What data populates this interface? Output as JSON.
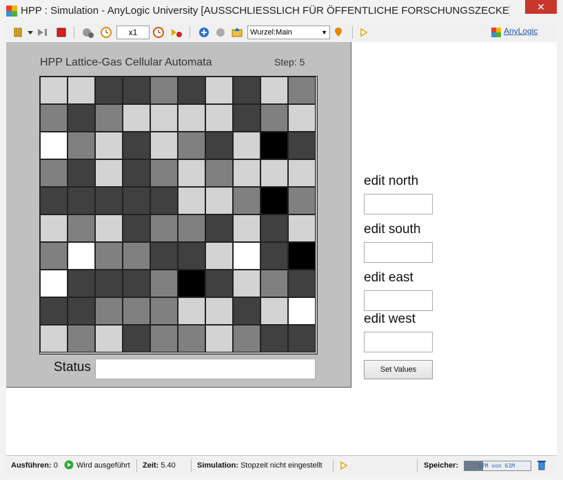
{
  "window": {
    "title": "HPP : Simulation - AnyLogic University  [AUSSCHLIESSLICH FÜR ÖFFENTLICHE FORSCHUNGSZECKE] [...",
    "close_label": "✕"
  },
  "toolbar": {
    "speed_value": "x1",
    "navigate_value": "Wurzel:Main",
    "anylogic_link": "AnyLogic"
  },
  "model": {
    "title": "HPP Lattice-Gas Cellular Automata",
    "step_label": "Step: 5",
    "grid": [
      [
        "light",
        "light",
        "dark",
        "dark",
        "mid",
        "dark",
        "light",
        "dark",
        "light",
        "mid"
      ],
      [
        "mid",
        "dark",
        "mid",
        "light",
        "light",
        "light",
        "light",
        "dark",
        "mid",
        "light"
      ],
      [
        "white",
        "mid",
        "light",
        "dark",
        "light",
        "mid",
        "dark",
        "light",
        "black",
        "dark"
      ],
      [
        "mid",
        "dark",
        "light",
        "dark",
        "mid",
        "light",
        "mid",
        "light",
        "light",
        "light"
      ],
      [
        "dark",
        "dark",
        "dark",
        "dark",
        "dark",
        "light",
        "light",
        "mid",
        "black",
        "mid"
      ],
      [
        "light",
        "mid",
        "light",
        "dark",
        "mid",
        "mid",
        "dark",
        "light",
        "dark",
        "light"
      ],
      [
        "mid",
        "white",
        "mid",
        "mid",
        "dark",
        "dark",
        "light",
        "white",
        "dark",
        "black"
      ],
      [
        "white",
        "dark",
        "dark",
        "dark",
        "mid",
        "black",
        "dark",
        "light",
        "mid",
        "dark"
      ],
      [
        "dark",
        "dark",
        "mid",
        "mid",
        "mid",
        "light",
        "light",
        "dark",
        "light",
        "white"
      ],
      [
        "light",
        "mid",
        "light",
        "dark",
        "mid",
        "mid",
        "light",
        "mid",
        "dark",
        "dark"
      ]
    ],
    "shade_colors": {
      "white": "#ffffff",
      "light": "#d3d3d3",
      "mid": "#808080",
      "dark": "#404040",
      "black": "#000000"
    },
    "status_label": "Status",
    "status_value": ""
  },
  "controls": {
    "north_label": "edit north",
    "south_label": "edit south",
    "east_label": "edit east",
    "west_label": "edit west",
    "north_value": "",
    "south_value": "",
    "east_value": "",
    "west_value": "",
    "set_button": "Set Values"
  },
  "statusbar": {
    "run_label": "Ausführen:",
    "run_count": "0",
    "run_state": "Wird ausgeführt",
    "time_label": "Zeit:",
    "time_value": "5.40",
    "sim_label": "Simulation:",
    "sim_value": "Stopzeit nicht eingestellt",
    "mem_label": "Speicher:",
    "mem_value": "17M von 61M",
    "mem_fraction": 0.28
  }
}
